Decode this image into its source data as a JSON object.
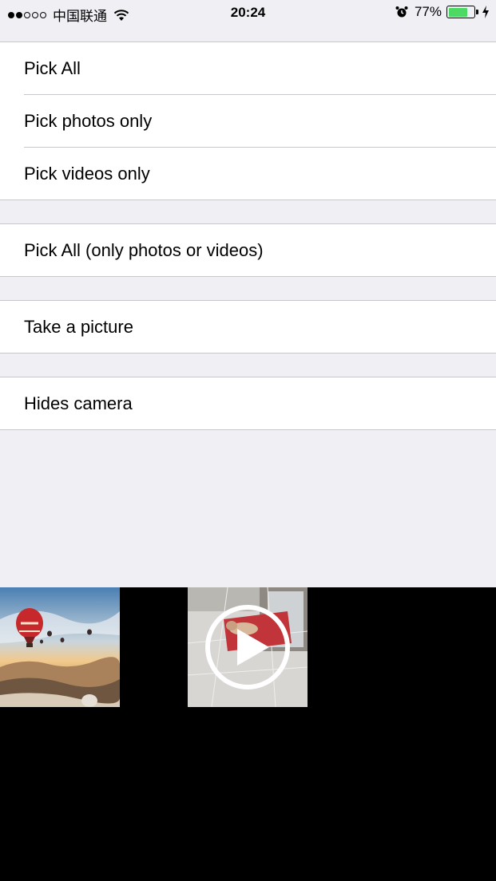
{
  "status_bar": {
    "carrier": "中国联通",
    "time": "20:24",
    "battery_percent": "77%",
    "battery_level": 0.77,
    "signal_strength": 2,
    "signal_max": 5
  },
  "groups": [
    {
      "items": [
        "Pick All",
        "Pick photos only",
        "Pick videos only"
      ]
    },
    {
      "items": [
        "Pick All (only photos or videos)"
      ]
    },
    {
      "items": [
        "Take a picture"
      ]
    },
    {
      "items": [
        "Hides camera"
      ]
    }
  ],
  "media": [
    {
      "type": "photo",
      "icon": "hot-air-balloon-photo"
    },
    {
      "type": "video",
      "icon": "play-icon"
    }
  ],
  "colors": {
    "background": "#efeff4",
    "battery": "#4cd964",
    "strip": "#000000"
  }
}
